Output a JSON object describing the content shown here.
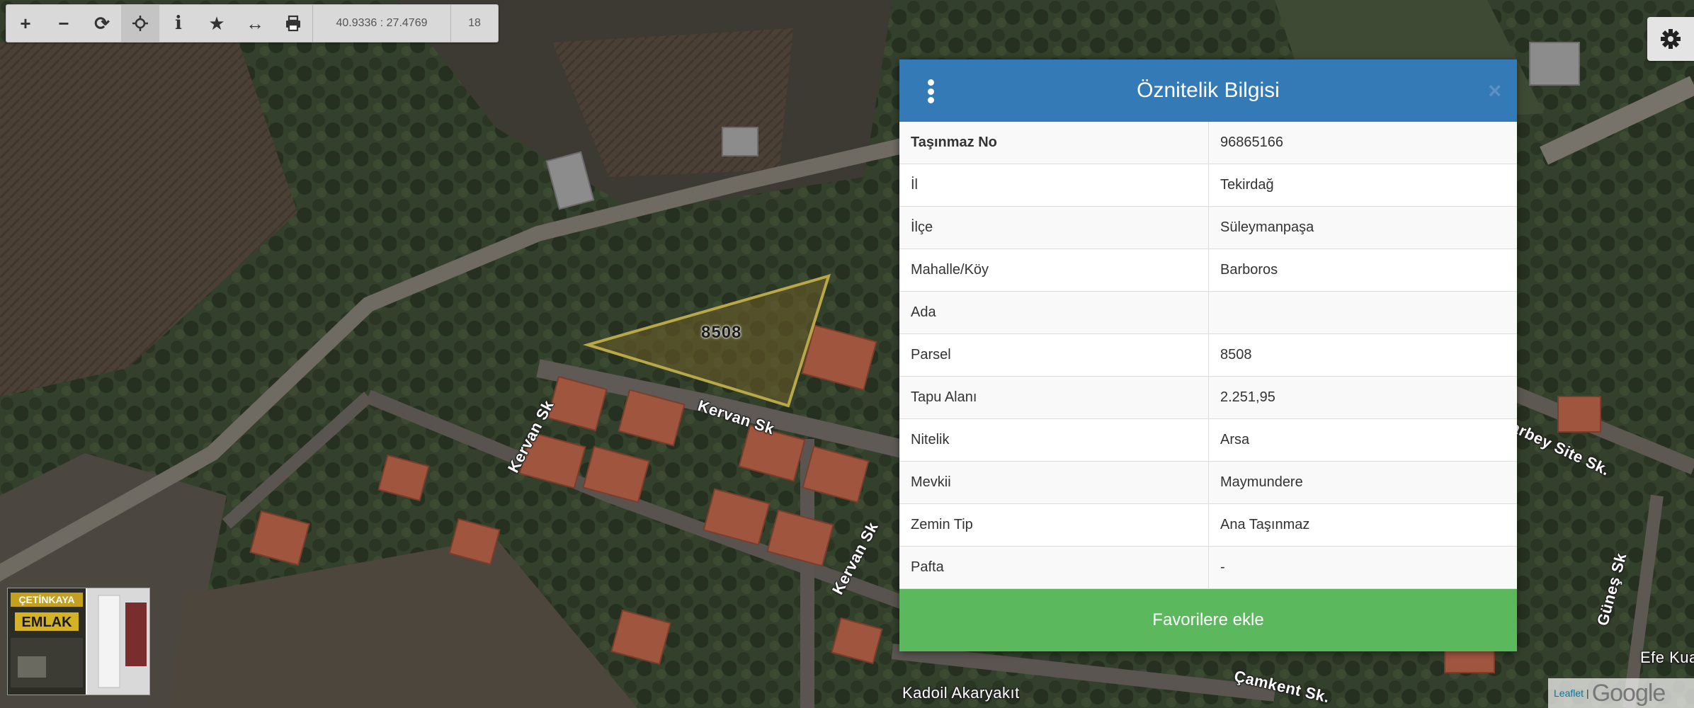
{
  "toolbar": {
    "buttons": [
      {
        "name": "zoom-in",
        "icon": "plus-icon",
        "glyph": "+"
      },
      {
        "name": "zoom-out",
        "icon": "minus-icon",
        "glyph": "−"
      },
      {
        "name": "refresh",
        "icon": "refresh-icon",
        "glyph": "⟳"
      },
      {
        "name": "locate",
        "icon": "crosshair-icon",
        "glyph": "⌖"
      },
      {
        "name": "info",
        "icon": "info-icon",
        "glyph": "i"
      },
      {
        "name": "favorite",
        "icon": "star-icon",
        "glyph": "★"
      },
      {
        "name": "measure",
        "icon": "ruler-icon",
        "glyph": "↔"
      },
      {
        "name": "print",
        "icon": "print-icon",
        "glyph": "⎙"
      }
    ],
    "coords": "40.9336 : 27.4769",
    "zoom": "18"
  },
  "map": {
    "parcel_label": "8508",
    "streets": [
      {
        "name": "kervan-sk-1",
        "text": "Kervan Sk"
      },
      {
        "name": "kervan-sk-2",
        "text": "Kervan Sk"
      },
      {
        "name": "kervan-sk-3",
        "text": "Kervan Sk"
      },
      {
        "name": "rbey-site-sk",
        "text": "arbey Site Sk."
      },
      {
        "name": "gunes-sk",
        "text": "Güneş Sk"
      },
      {
        "name": "camkent-sk",
        "text": "Çamkent Sk."
      },
      {
        "name": "kadoil",
        "text": "Kadoil Akaryakıt"
      },
      {
        "name": "efe-kua",
        "text": "Efe Kua"
      }
    ]
  },
  "panel": {
    "title": "Öznitelik Bilgisi",
    "close": "×",
    "rows": [
      {
        "key": "Taşınmaz No",
        "value": "96865166"
      },
      {
        "key": "İl",
        "value": "Tekirdağ"
      },
      {
        "key": "İlçe",
        "value": "Süleymanpaşa"
      },
      {
        "key": "Mahalle/Köy",
        "value": "Barboros"
      },
      {
        "key": "Ada",
        "value": ""
      },
      {
        "key": "Parsel",
        "value": "8508"
      },
      {
        "key": "Tapu Alanı",
        "value": "2.251,95"
      },
      {
        "key": "Nitelik",
        "value": "Arsa"
      },
      {
        "key": "Mevkii",
        "value": "Maymundere"
      },
      {
        "key": "Zemin Tip",
        "value": "Ana Taşınmaz"
      },
      {
        "key": "Pafta",
        "value": "-"
      }
    ],
    "favorite_button": "Favorilere ekle",
    "header_color": "#337ab7",
    "button_color": "#5cb85c"
  },
  "logo": {
    "line1": "ÇETİNKAYA",
    "line2": "EMLAK"
  },
  "attribution": {
    "leaflet": "Leaflet",
    "separator": "|",
    "google": "Google"
  }
}
